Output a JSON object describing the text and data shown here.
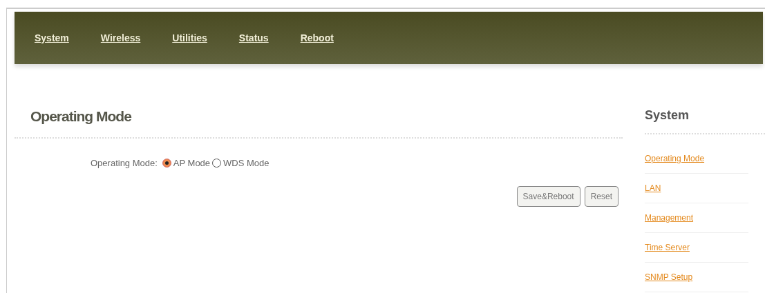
{
  "nav": [
    {
      "label": "System"
    },
    {
      "label": "Wireless"
    },
    {
      "label": "Utilities"
    },
    {
      "label": "Status"
    },
    {
      "label": "Reboot"
    }
  ],
  "main": {
    "title": "Operating Mode",
    "field_label": "Operating Mode:",
    "options": [
      {
        "label": "AP Mode",
        "selected": true
      },
      {
        "label": "WDS Mode",
        "selected": false
      }
    ],
    "buttons": [
      "Save&Reboot",
      "Reset"
    ]
  },
  "sidebar": {
    "title": "System",
    "links": [
      "Operating Mode",
      "LAN",
      "Management",
      "Time Server",
      "SNMP Setup"
    ]
  }
}
